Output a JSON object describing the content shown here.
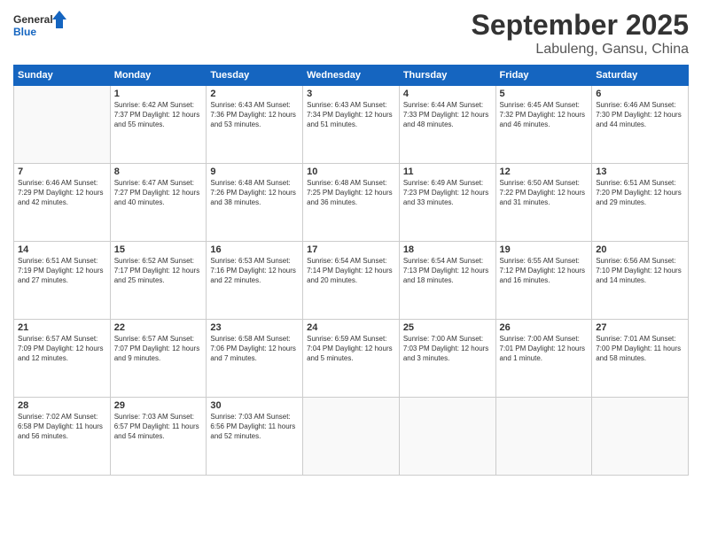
{
  "header": {
    "logo_line1": "General",
    "logo_line2": "Blue",
    "month": "September 2025",
    "location": "Labuleng, Gansu, China"
  },
  "weekdays": [
    "Sunday",
    "Monday",
    "Tuesday",
    "Wednesday",
    "Thursday",
    "Friday",
    "Saturday"
  ],
  "weeks": [
    [
      {
        "day": "",
        "info": ""
      },
      {
        "day": "1",
        "info": "Sunrise: 6:42 AM\nSunset: 7:37 PM\nDaylight: 12 hours\nand 55 minutes."
      },
      {
        "day": "2",
        "info": "Sunrise: 6:43 AM\nSunset: 7:36 PM\nDaylight: 12 hours\nand 53 minutes."
      },
      {
        "day": "3",
        "info": "Sunrise: 6:43 AM\nSunset: 7:34 PM\nDaylight: 12 hours\nand 51 minutes."
      },
      {
        "day": "4",
        "info": "Sunrise: 6:44 AM\nSunset: 7:33 PM\nDaylight: 12 hours\nand 48 minutes."
      },
      {
        "day": "5",
        "info": "Sunrise: 6:45 AM\nSunset: 7:32 PM\nDaylight: 12 hours\nand 46 minutes."
      },
      {
        "day": "6",
        "info": "Sunrise: 6:46 AM\nSunset: 7:30 PM\nDaylight: 12 hours\nand 44 minutes."
      }
    ],
    [
      {
        "day": "7",
        "info": "Sunrise: 6:46 AM\nSunset: 7:29 PM\nDaylight: 12 hours\nand 42 minutes."
      },
      {
        "day": "8",
        "info": "Sunrise: 6:47 AM\nSunset: 7:27 PM\nDaylight: 12 hours\nand 40 minutes."
      },
      {
        "day": "9",
        "info": "Sunrise: 6:48 AM\nSunset: 7:26 PM\nDaylight: 12 hours\nand 38 minutes."
      },
      {
        "day": "10",
        "info": "Sunrise: 6:48 AM\nSunset: 7:25 PM\nDaylight: 12 hours\nand 36 minutes."
      },
      {
        "day": "11",
        "info": "Sunrise: 6:49 AM\nSunset: 7:23 PM\nDaylight: 12 hours\nand 33 minutes."
      },
      {
        "day": "12",
        "info": "Sunrise: 6:50 AM\nSunset: 7:22 PM\nDaylight: 12 hours\nand 31 minutes."
      },
      {
        "day": "13",
        "info": "Sunrise: 6:51 AM\nSunset: 7:20 PM\nDaylight: 12 hours\nand 29 minutes."
      }
    ],
    [
      {
        "day": "14",
        "info": "Sunrise: 6:51 AM\nSunset: 7:19 PM\nDaylight: 12 hours\nand 27 minutes."
      },
      {
        "day": "15",
        "info": "Sunrise: 6:52 AM\nSunset: 7:17 PM\nDaylight: 12 hours\nand 25 minutes."
      },
      {
        "day": "16",
        "info": "Sunrise: 6:53 AM\nSunset: 7:16 PM\nDaylight: 12 hours\nand 22 minutes."
      },
      {
        "day": "17",
        "info": "Sunrise: 6:54 AM\nSunset: 7:14 PM\nDaylight: 12 hours\nand 20 minutes."
      },
      {
        "day": "18",
        "info": "Sunrise: 6:54 AM\nSunset: 7:13 PM\nDaylight: 12 hours\nand 18 minutes."
      },
      {
        "day": "19",
        "info": "Sunrise: 6:55 AM\nSunset: 7:12 PM\nDaylight: 12 hours\nand 16 minutes."
      },
      {
        "day": "20",
        "info": "Sunrise: 6:56 AM\nSunset: 7:10 PM\nDaylight: 12 hours\nand 14 minutes."
      }
    ],
    [
      {
        "day": "21",
        "info": "Sunrise: 6:57 AM\nSunset: 7:09 PM\nDaylight: 12 hours\nand 12 minutes."
      },
      {
        "day": "22",
        "info": "Sunrise: 6:57 AM\nSunset: 7:07 PM\nDaylight: 12 hours\nand 9 minutes."
      },
      {
        "day": "23",
        "info": "Sunrise: 6:58 AM\nSunset: 7:06 PM\nDaylight: 12 hours\nand 7 minutes."
      },
      {
        "day": "24",
        "info": "Sunrise: 6:59 AM\nSunset: 7:04 PM\nDaylight: 12 hours\nand 5 minutes."
      },
      {
        "day": "25",
        "info": "Sunrise: 7:00 AM\nSunset: 7:03 PM\nDaylight: 12 hours\nand 3 minutes."
      },
      {
        "day": "26",
        "info": "Sunrise: 7:00 AM\nSunset: 7:01 PM\nDaylight: 12 hours\nand 1 minute."
      },
      {
        "day": "27",
        "info": "Sunrise: 7:01 AM\nSunset: 7:00 PM\nDaylight: 11 hours\nand 58 minutes."
      }
    ],
    [
      {
        "day": "28",
        "info": "Sunrise: 7:02 AM\nSunset: 6:58 PM\nDaylight: 11 hours\nand 56 minutes."
      },
      {
        "day": "29",
        "info": "Sunrise: 7:03 AM\nSunset: 6:57 PM\nDaylight: 11 hours\nand 54 minutes."
      },
      {
        "day": "30",
        "info": "Sunrise: 7:03 AM\nSunset: 6:56 PM\nDaylight: 11 hours\nand 52 minutes."
      },
      {
        "day": "",
        "info": ""
      },
      {
        "day": "",
        "info": ""
      },
      {
        "day": "",
        "info": ""
      },
      {
        "day": "",
        "info": ""
      }
    ]
  ]
}
